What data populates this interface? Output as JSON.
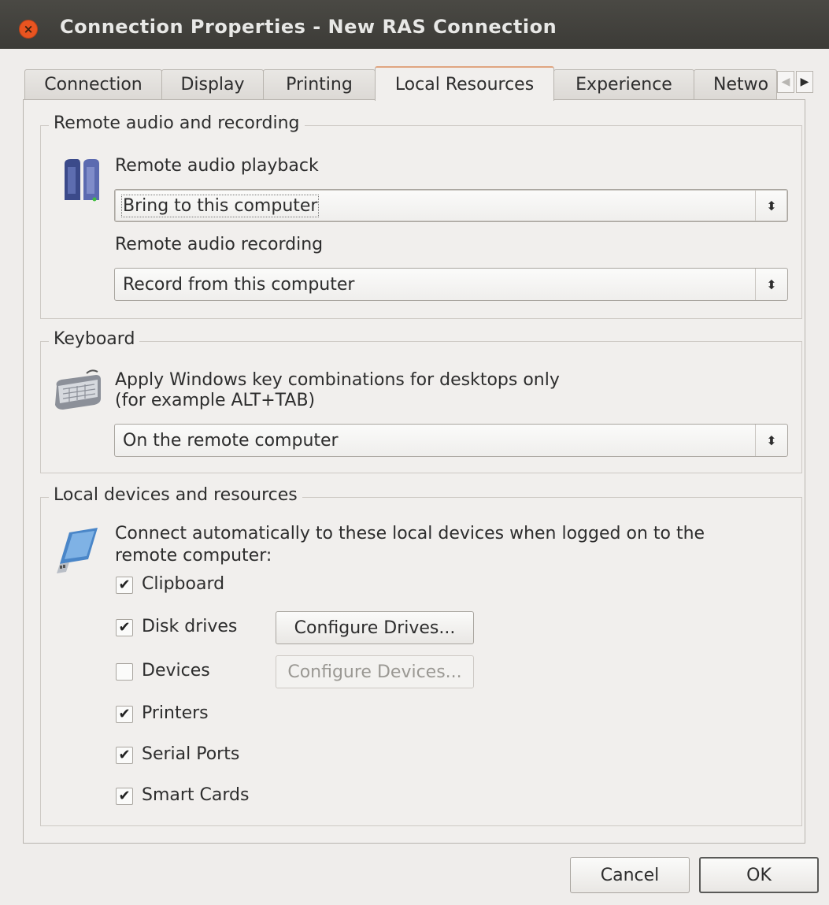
{
  "window": {
    "title": "Connection Properties - New RAS Connection",
    "close_glyph": "×"
  },
  "tabs": [
    {
      "label": "Connection"
    },
    {
      "label": "Display"
    },
    {
      "label": "Printing"
    },
    {
      "label": "Local Resources",
      "active": true
    },
    {
      "label": "Experience"
    },
    {
      "label": "Netwo"
    }
  ],
  "tab_scroll": {
    "left_glyph": "◀",
    "right_glyph": "▶"
  },
  "audio": {
    "group_title": "Remote audio and recording",
    "icon": "speakers-icon",
    "playback_label": "Remote audio playback",
    "playback_value": "Bring to this computer",
    "recording_label": "Remote audio recording",
    "recording_value": "Record from this computer"
  },
  "keyboard": {
    "group_title": "Keyboard",
    "icon": "keyboard-icon",
    "label_line1": "Apply Windows key combinations for desktops only",
    "label_line2": "(for example ALT+TAB)",
    "value": "On the remote computer"
  },
  "devices": {
    "group_title": "Local devices and resources",
    "icon": "usb-drive-icon",
    "description_line1": "Connect automatically to these local devices when logged on to the",
    "description_line2": "remote computer:",
    "items": [
      {
        "label": "Clipboard",
        "checked": true
      },
      {
        "label": "Disk drives",
        "checked": true
      },
      {
        "label": "Devices",
        "checked": false
      },
      {
        "label": "Printers",
        "checked": true
      },
      {
        "label": "Serial Ports",
        "checked": true
      },
      {
        "label": "Smart Cards",
        "checked": true
      }
    ],
    "configure_drives_label": "Configure Drives...",
    "configure_devices_label": "Configure Devices..."
  },
  "combo_arrow_glyph": "⬍",
  "check_glyph": "✔",
  "footer": {
    "cancel_label": "Cancel",
    "ok_label": "OK"
  },
  "colors": {
    "titlebar": "#3c3b37",
    "close": "#e95420",
    "background": "#efedeb",
    "active_tab_accent": "#e0a580"
  }
}
